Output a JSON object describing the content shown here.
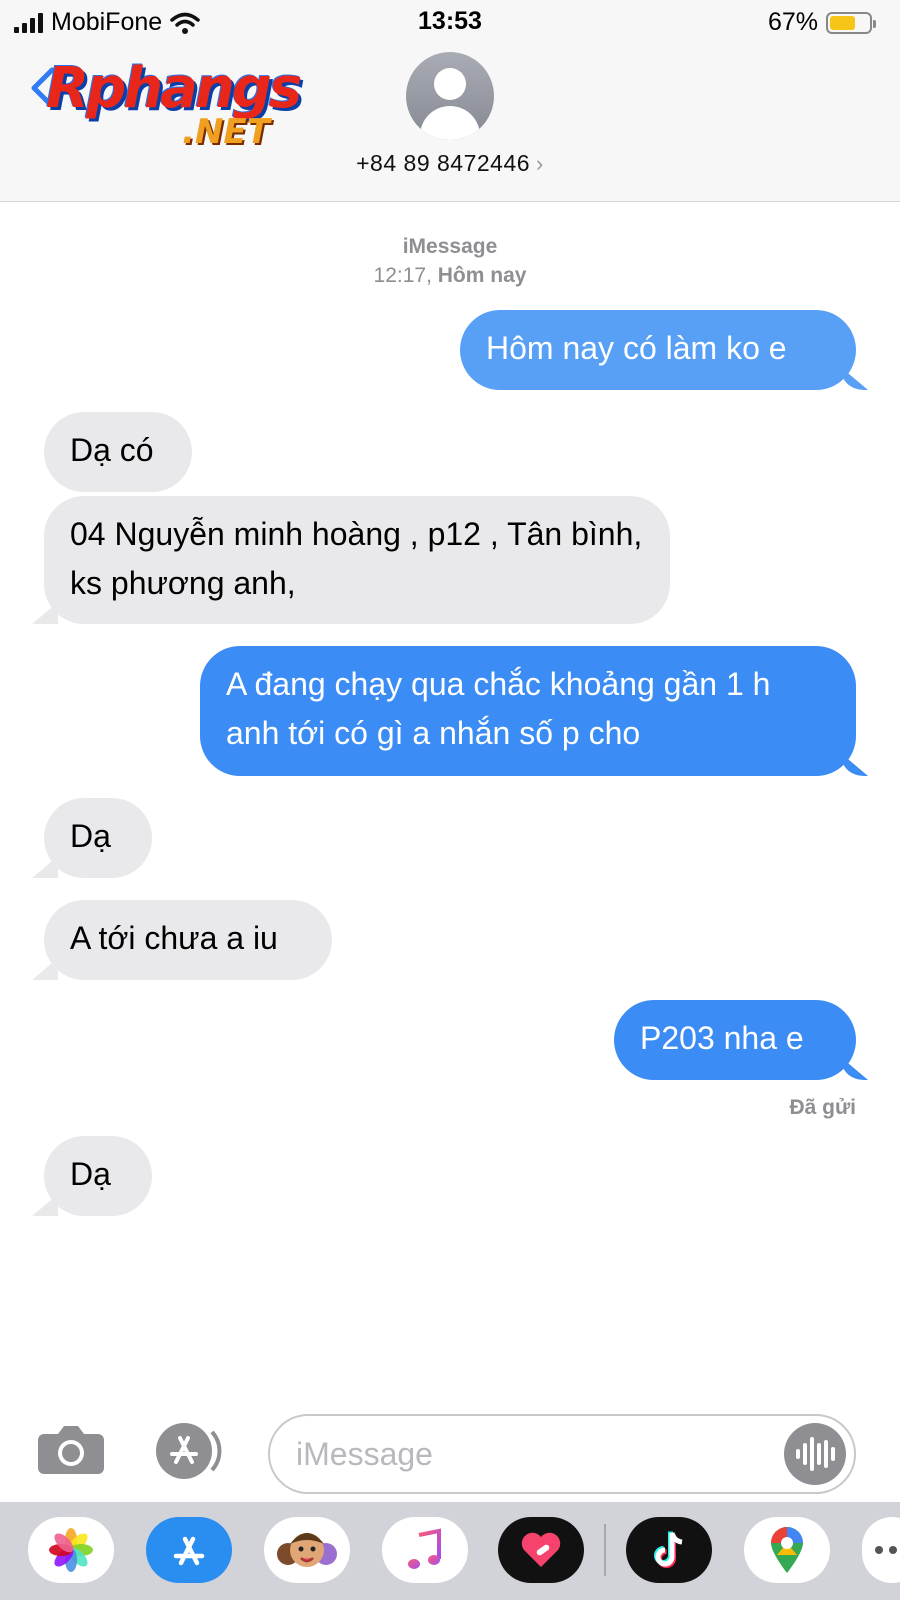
{
  "status_bar": {
    "carrier": "MobiFone",
    "time": "13:53",
    "battery_percent": "67%",
    "battery_level": 0.67,
    "battery_color": "#f5c518"
  },
  "header": {
    "back_icon": "chevron-left-icon",
    "logo_text_1": "Rphangs",
    "logo_text_2": ".NET",
    "contact_number": "+84 89 8472446",
    "contact_chevron": "›"
  },
  "thread": {
    "service": "iMessage",
    "time": "12:17,",
    "day": "Hôm nay",
    "messages": [
      {
        "side": "out",
        "text": "Hôm nay có làm ko e"
      },
      {
        "side": "in",
        "text": "Dạ có"
      },
      {
        "side": "in",
        "text": "04 Nguyễn minh hoàng , p12 , Tân bình, ks phương anh,"
      },
      {
        "side": "out",
        "text": "A đang chạy qua chắc khoảng gần 1 h anh tới có gì a nhắn số p cho"
      },
      {
        "side": "in",
        "text": "Dạ"
      },
      {
        "side": "in",
        "text": "A tới chưa a iu"
      },
      {
        "side": "out",
        "text": "P203 nha e"
      },
      {
        "side": "in",
        "text": "Dạ"
      }
    ],
    "delivered_label": "Đã gửi"
  },
  "compose": {
    "placeholder": "iMessage",
    "camera_icon": "camera-icon",
    "appstore_icon": "app-store-icon",
    "audio_icon": "audio-waveform-icon"
  },
  "drawer": {
    "apps": [
      "photos-icon",
      "app-store-icon",
      "memoji-icon",
      "music-icon",
      "heart-app-icon",
      "tiktok-icon",
      "maps-icon",
      "more-icon"
    ]
  },
  "colors": {
    "outgoing_bubble": "#3b8cf4",
    "incoming_bubble": "#e9e9eb",
    "meta_gray": "#8e8e93"
  }
}
